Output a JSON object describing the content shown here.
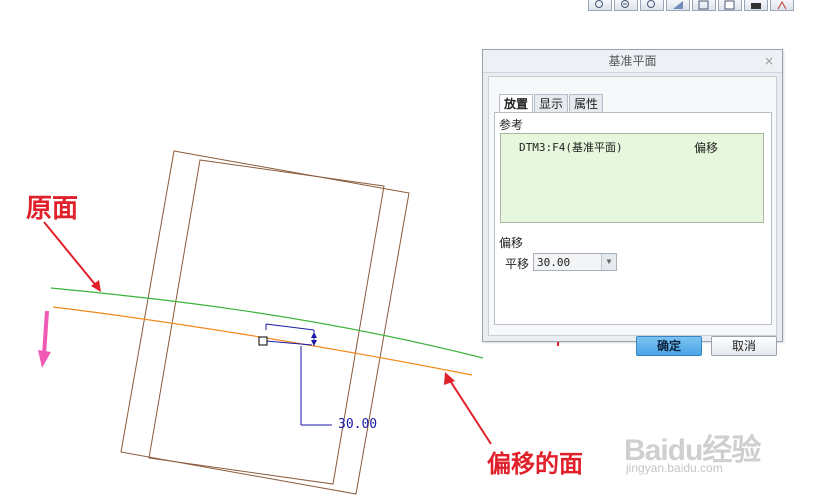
{
  "toolbar": {
    "icons": [
      "zoom-fit-icon",
      "zoom-in-icon",
      "zoom-out-icon",
      "repaint-icon",
      "orient-icon",
      "view-list-icon",
      "camera-icon",
      "spin-center-icon"
    ]
  },
  "viewport": {
    "dimension_value": "30.00"
  },
  "annotations": {
    "original_plane": "原面",
    "offset_plane": "偏移的面"
  },
  "colors": {
    "original_plane": "#3cb43c",
    "offset_plane": "#f28a1e",
    "annotation": "#e0202a",
    "arrow_pink": "#f05ab4",
    "dimension": "#1a1aa8",
    "wireframe": "#8b5a3c"
  },
  "dialog": {
    "title": "基准平面",
    "close_label": "×",
    "tabs": [
      "放置",
      "显示",
      "属性"
    ],
    "active_tab": "放置",
    "reference_label": "参考",
    "reference": {
      "name": "DTM3:F4(基准平面)",
      "type": "偏移"
    },
    "offset_section_label": "偏移",
    "translation_label": "平移",
    "translation_value": "30.00",
    "ok_label": "确定",
    "cancel_label": "取消"
  },
  "watermark": {
    "logo": "Baidu经验",
    "url": "jingyan.baidu.com"
  }
}
